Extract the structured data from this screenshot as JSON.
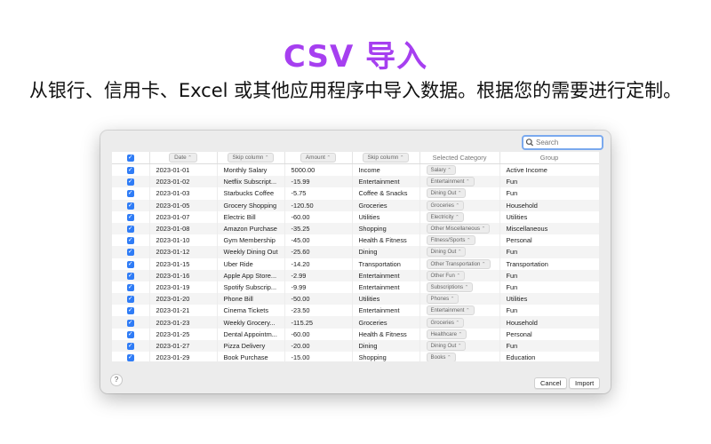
{
  "hero": {
    "title": "CSV 导入",
    "subtitle": "从银行、信用卡、Excel 或其他应用程序中导入数据。根据您的需要进行定制。"
  },
  "search": {
    "placeholder": "Search",
    "icon": "magnifier-icon"
  },
  "columns": [
    {
      "label": "",
      "type": "checkbox"
    },
    {
      "label": "Date",
      "type": "dropdown"
    },
    {
      "label": "Skip column",
      "type": "dropdown"
    },
    {
      "label": "Amount",
      "type": "dropdown"
    },
    {
      "label": "Skip column",
      "type": "dropdown"
    },
    {
      "label": "Selected Category",
      "type": "text"
    },
    {
      "label": "Group",
      "type": "text"
    }
  ],
  "rows": [
    {
      "date": "2023-01-01",
      "description": "Monthly Salary",
      "amount": "5000.00",
      "category": "Income",
      "selected_category": "Salary",
      "group": "Active Income"
    },
    {
      "date": "2023-01-02",
      "description": "Netflix Subscript...",
      "amount": "-15.99",
      "category": "Entertainment",
      "selected_category": "Entertainment",
      "group": "Fun"
    },
    {
      "date": "2023-01-03",
      "description": "Starbucks Coffee",
      "amount": "-5.75",
      "category": "Coffee & Snacks",
      "selected_category": "Dining Out",
      "group": "Fun"
    },
    {
      "date": "2023-01-05",
      "description": "Grocery Shopping",
      "amount": "-120.50",
      "category": "Groceries",
      "selected_category": "Groceries",
      "group": "Household"
    },
    {
      "date": "2023-01-07",
      "description": "Electric Bill",
      "amount": "-60.00",
      "category": "Utilities",
      "selected_category": "Electricity",
      "group": "Utilities"
    },
    {
      "date": "2023-01-08",
      "description": "Amazon Purchase",
      "amount": "-35.25",
      "category": "Shopping",
      "selected_category": "Other Miscellaneous",
      "group": "Miscellaneous"
    },
    {
      "date": "2023-01-10",
      "description": "Gym Membership",
      "amount": "-45.00",
      "category": "Health & Fitness",
      "selected_category": "Fitness/Sports",
      "group": "Personal"
    },
    {
      "date": "2023-01-12",
      "description": "Weekly Dining Out",
      "amount": "-25.60",
      "category": "Dining",
      "selected_category": "Dining Out",
      "group": "Fun"
    },
    {
      "date": "2023-01-15",
      "description": "Uber Ride",
      "amount": "-14.20",
      "category": "Transportation",
      "selected_category": "Other Transportation",
      "group": "Transportation"
    },
    {
      "date": "2023-01-16",
      "description": "Apple App Store...",
      "amount": "-2.99",
      "category": "Entertainment",
      "selected_category": "Other Fun",
      "group": "Fun"
    },
    {
      "date": "2023-01-19",
      "description": "Spotify Subscrip...",
      "amount": "-9.99",
      "category": "Entertainment",
      "selected_category": "Subscriptions",
      "group": "Fun"
    },
    {
      "date": "2023-01-20",
      "description": "Phone Bill",
      "amount": "-50.00",
      "category": "Utilities",
      "selected_category": "Phones",
      "group": "Utilities"
    },
    {
      "date": "2023-01-21",
      "description": "Cinema Tickets",
      "amount": "-23.50",
      "category": "Entertainment",
      "selected_category": "Entertainment",
      "group": "Fun"
    },
    {
      "date": "2023-01-23",
      "description": "Weekly Grocery...",
      "amount": "-115.25",
      "category": "Groceries",
      "selected_category": "Groceries",
      "group": "Household"
    },
    {
      "date": "2023-01-25",
      "description": "Dental Appointm...",
      "amount": "-60.00",
      "category": "Health & Fitness",
      "selected_category": "Healthcare",
      "group": "Personal"
    },
    {
      "date": "2023-01-27",
      "description": "Pizza Delivery",
      "amount": "-20.00",
      "category": "Dining",
      "selected_category": "Dining Out",
      "group": "Fun"
    },
    {
      "date": "2023-01-29",
      "description": "Book Purchase",
      "amount": "-15.00",
      "category": "Shopping",
      "selected_category": "Books",
      "group": "Education"
    }
  ],
  "buttons": {
    "help": "?",
    "cancel": "Cancel",
    "import": "Import"
  },
  "colors": {
    "accent_title": "#a63ff0",
    "checkbox": "#2f7cf6",
    "focus_ring": "#7aa9ee"
  }
}
